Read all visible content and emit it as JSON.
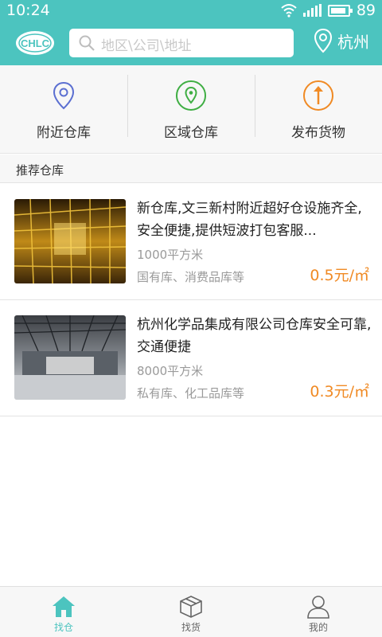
{
  "status_bar": {
    "time": "10:24",
    "battery": "89",
    "battery_fraction": 0.89
  },
  "header": {
    "logo_text": "CHLC",
    "search_placeholder": "地区\\公司\\地址",
    "city": "杭州"
  },
  "actions": [
    {
      "label": "附近仓库",
      "icon": "location-pin-icon",
      "color": "#5b6fd1"
    },
    {
      "label": "区域仓库",
      "icon": "map-pin-icon",
      "color": "#3fae43"
    },
    {
      "label": "发布货物",
      "icon": "upload-arrow-icon",
      "color": "#f08a24"
    }
  ],
  "section_title": "推荐仓库",
  "warehouses": [
    {
      "title": "新仓库,文三新村附近超好仓设施齐全,安全便捷,提供短波打包客服...",
      "area": "1000平方米",
      "type": "国有库、消费品库等",
      "price": "0.5元/㎡"
    },
    {
      "title": "杭州化学品集成有限公司仓库安全可靠,交通便捷",
      "area": "8000平方米",
      "type": "私有库、化工品库等",
      "price": "0.3元/㎡"
    }
  ],
  "tabs": [
    {
      "label": "找仓",
      "icon": "home-icon",
      "active": true
    },
    {
      "label": "找货",
      "icon": "box-icon",
      "active": false
    },
    {
      "label": "我的",
      "icon": "user-icon",
      "active": false
    }
  ],
  "colors": {
    "primary": "#4cc4bf",
    "price": "#f08a24"
  }
}
